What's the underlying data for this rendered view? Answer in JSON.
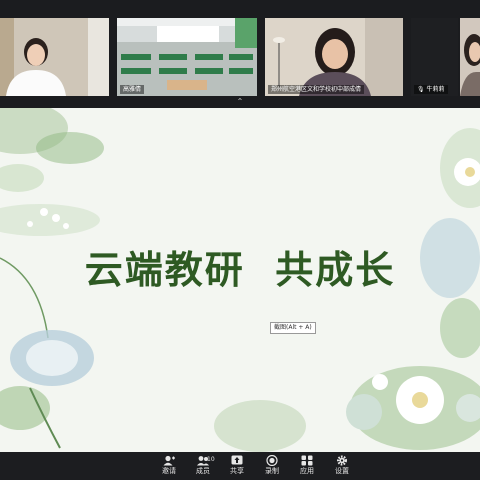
{
  "participants": [
    {
      "name": ""
    },
    {
      "name": "高雅倩"
    },
    {
      "name": "郑州航空港区文和学校初中部成倩"
    },
    {
      "name": "牛莉莉"
    },
    {
      "name": ""
    }
  ],
  "slide": {
    "title": "云端教研  共成长",
    "screenshot_tip": "截图(Alt + A)"
  },
  "toolbar": {
    "invite": "邀请",
    "members": "成员",
    "member_count": "10",
    "share": "共享",
    "record": "录制",
    "apps": "应用",
    "settings": "设置"
  },
  "colors": {
    "title_green": "#2e5a23",
    "toolbar_bg": "#1c1d20",
    "slide_bg": "#f3f6f1"
  }
}
